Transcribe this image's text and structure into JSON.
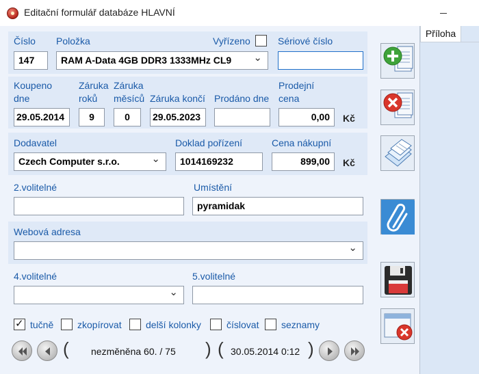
{
  "window": {
    "title": "Editační formulář databáze HLAVNÍ"
  },
  "labels": {
    "cislo": "Číslo",
    "polozka": "Položka",
    "vyrizeno": "Vyřízeno",
    "seriove": "Sériové číslo",
    "koupeno_1": "Koupeno",
    "koupeno_2": "dne",
    "zaruka_roku_1": "Záruka",
    "zaruka_roku_2": "roků",
    "zaruka_mesicu_1": "Záruka",
    "zaruka_mesicu_2": "měsíců",
    "zaruka_konci": "Záruka končí",
    "prodano": "Prodáno dne",
    "prodejni_1": "Prodejní",
    "prodejni_2": "cena",
    "dodavatel": "Dodavatel",
    "doklad": "Doklad pořízení",
    "cena_nakupni": "Cena nákupní",
    "volitelne2": "2.volitelné",
    "umisteni": "Umístění",
    "webova": "Webová adresa",
    "volitelne4": "4.volitelné",
    "volitelne5": "5.volitelné",
    "currency": "Kč"
  },
  "values": {
    "cislo": "147",
    "polozka": "RAM A-Data 4GB DDR3 1333MHz CL9",
    "vyrizeno_checked": false,
    "seriove": "",
    "koupeno": "29.05.2014",
    "zaruka_roku": "9",
    "zaruka_mesicu": "0",
    "zaruka_konci": "29.05.2023",
    "prodano": "",
    "prodejni_cena": "0,00",
    "dodavatel": "Czech Computer s.r.o.",
    "doklad": "1014169232",
    "cena_nakupni": "899,00",
    "volitelne2": "",
    "umisteni": "pyramidak",
    "webova": "",
    "volitelne4": "",
    "volitelne5": ""
  },
  "options": [
    {
      "label": "tučně",
      "checked": true
    },
    {
      "label": "zkopírovat",
      "checked": false
    },
    {
      "label": "delší kolonky",
      "checked": false
    },
    {
      "label": "číslovat",
      "checked": false
    },
    {
      "label": "seznamy",
      "checked": false
    }
  ],
  "navigation": {
    "status": "nezměněna 60.  / 75",
    "timestamp": "30.05.2014 0:12"
  },
  "side_buttons": [
    "add-record-icon",
    "delete-record-icon",
    "copy-records-icon",
    "attachment-icon",
    "save-icon",
    "close-window-icon"
  ],
  "right_panel": {
    "tab_label": "Příloha"
  },
  "colors": {
    "label_blue": "#1a5aa8",
    "band": "#dfe9f7",
    "form_bg": "#eef3fb",
    "panel_bg": "#dbe7f6"
  }
}
